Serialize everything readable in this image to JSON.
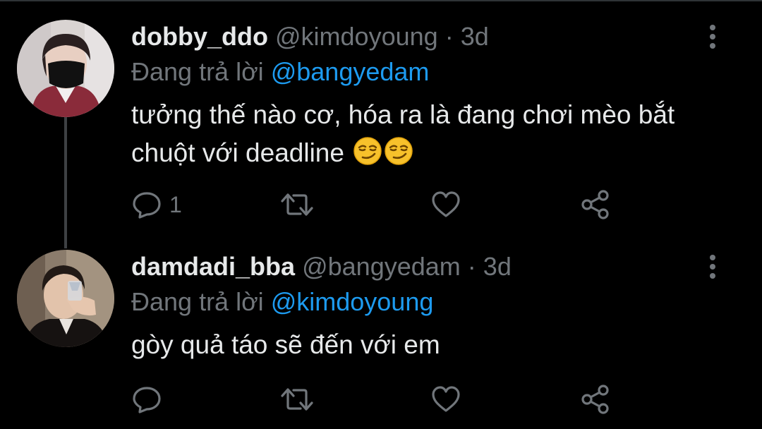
{
  "tweets": [
    {
      "display_name": "dobby_ddo",
      "handle": "@kimdoyoung",
      "separator": "·",
      "time": "3d",
      "reply_prefix": "Đang trả lời",
      "reply_to": "@bangyedam",
      "text_line1": "tưởng thế nào cơ, hóa ra là đang chơi mèo bắt",
      "text_line2": "chuột với deadline",
      "emojis": [
        "smirking-face-emoji",
        "smirking-face-emoji"
      ],
      "reply_count": "1",
      "avatar_icon": "avatar-masked-person"
    },
    {
      "display_name": "damdadi_bba",
      "handle": "@bangyedam",
      "separator": "·",
      "time": "3d",
      "reply_prefix": "Đang trả lời",
      "reply_to": "@kimdoyoung",
      "text_line1": "gòy quả táo sẽ đến với em",
      "reply_count": "",
      "avatar_icon": "avatar-person-drinking"
    }
  ],
  "colors": {
    "background": "#000000",
    "text": "#e7e9ea",
    "muted": "#71767b",
    "link": "#1d9bf0",
    "connector": "#3e4144"
  },
  "action_icons": [
    "reply-icon",
    "retweet-icon",
    "like-icon",
    "share-icon"
  ]
}
